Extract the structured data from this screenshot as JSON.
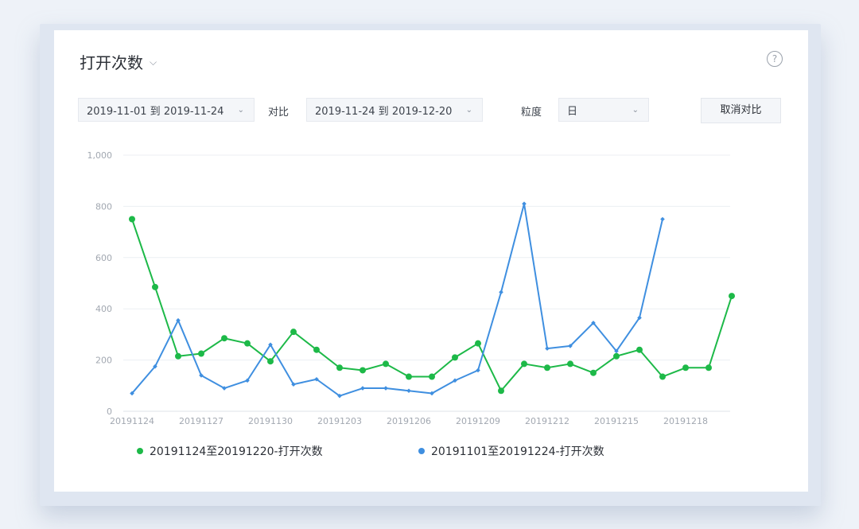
{
  "panel": {
    "title": "打开次数",
    "title_chevron": "⌵",
    "help_icon": "?"
  },
  "filters": {
    "range1": "2019-11-01 到 2019-11-24",
    "compare_label": "对比",
    "range2": "2019-11-24 到 2019-12-20",
    "granularity_label": "粒度",
    "granularity_value": "日",
    "cancel_compare": "取消对比"
  },
  "colors": {
    "green": "#1db948",
    "blue": "#3f8fe0",
    "grid": "#eceff3",
    "axis_text": "#a2a8b1"
  },
  "chart_data": {
    "type": "line",
    "x": [
      "20191124",
      "20191125",
      "20191126",
      "20191127",
      "20191128",
      "20191129",
      "20191130",
      "20191201",
      "20191202",
      "20191203",
      "20191204",
      "20191205",
      "20191206",
      "20191207",
      "20191208",
      "20191209",
      "20191210",
      "20191211",
      "20191212",
      "20191213",
      "20191214",
      "20191215",
      "20191216",
      "20191217",
      "20191218",
      "20191219",
      "20191220"
    ],
    "x_tick_labels": [
      "20191124",
      "20191127",
      "20191130",
      "20191203",
      "20191206",
      "20191209",
      "20191212",
      "20191215",
      "20191218"
    ],
    "y_ticks": [
      "0",
      "200",
      "400",
      "600",
      "800",
      "1,000"
    ],
    "ylim": [
      0,
      1000
    ],
    "grid": true,
    "legend_position": "bottom",
    "series": [
      {
        "name": "20191124至20191220-打开次数",
        "values": [
          750,
          485,
          215,
          225,
          285,
          265,
          195,
          310,
          240,
          170,
          160,
          185,
          135,
          135,
          210,
          265,
          80,
          185,
          170,
          185,
          150,
          215,
          240,
          135,
          170,
          170,
          450
        ]
      },
      {
        "name": "20191101至20191224-打开次数",
        "values": [
          70,
          175,
          355,
          140,
          90,
          120,
          260,
          105,
          125,
          60,
          90,
          90,
          80,
          70,
          120,
          160,
          465,
          810,
          245,
          255,
          345,
          235,
          365,
          750
        ]
      }
    ]
  }
}
